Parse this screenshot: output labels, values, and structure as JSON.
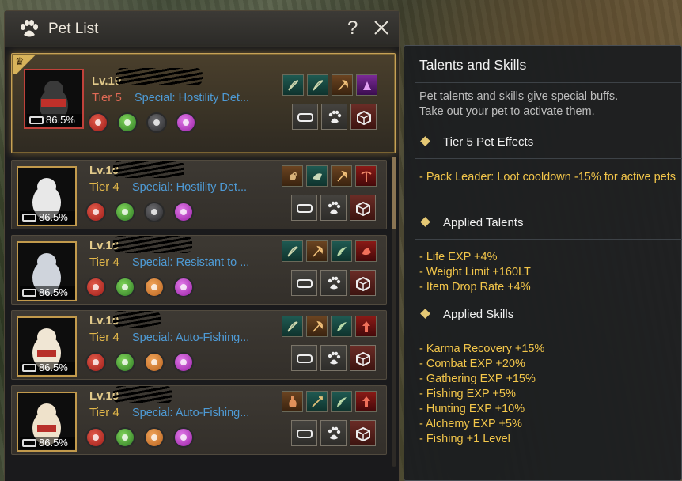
{
  "window": {
    "title": "Pet List",
    "help_label": "?"
  },
  "pets": [
    {
      "level": "Lv.10",
      "tier": "Tier 5",
      "tier_color": "#e06a55",
      "special": "Special: Hostility Det...",
      "hunger": "86.5%",
      "selected": true,
      "talents": [
        "bow-icon",
        "bow-icon",
        "axe-icon",
        "purple-tier-icon"
      ],
      "skills": [
        "red",
        "green",
        "gray",
        "purple"
      ]
    },
    {
      "level": "Lv.10",
      "tier": "Tier 4",
      "tier_color": "#e3b84a",
      "special": "Special: Hostility Det...",
      "hunger": "86.5%",
      "talents": [
        "scorpion-icon",
        "wolf-icon",
        "axe-icon",
        "pickaxe-icon"
      ],
      "skills": [
        "red",
        "green",
        "gray",
        "purple"
      ]
    },
    {
      "level": "Lv.10",
      "tier": "Tier 4",
      "tier_color": "#e3b84a",
      "special": "Special: Resistant to ...",
      "hunger": "86.5%",
      "talents": [
        "bow-icon",
        "axe-icon",
        "wing-icon",
        "hand-icon"
      ],
      "skills": [
        "red",
        "green",
        "orange",
        "purple"
      ]
    },
    {
      "level": "Lv.10",
      "tier": "Tier 4",
      "tier_color": "#e3b84a",
      "special": "Special: Auto-Fishing...",
      "hunger": "86.5%",
      "talents": [
        "bow-icon",
        "axe-icon",
        "wing-icon",
        "tier-up-icon"
      ],
      "skills": [
        "red",
        "green",
        "orange",
        "purple"
      ]
    },
    {
      "level": "Lv.10",
      "tier": "Tier 4",
      "tier_color": "#e3b84a",
      "special": "Special: Auto-Fishing...",
      "hunger": "86.5%",
      "talents": [
        "potion-icon",
        "spear-icon",
        "wing-icon",
        "tier-up-icon"
      ],
      "skills": [
        "red",
        "green",
        "orange",
        "purple"
      ]
    }
  ],
  "tooltip": {
    "title": "Talents and Skills",
    "description_1": "Pet talents and skills give special buffs.",
    "description_2": "Take out your pet to activate them.",
    "effects_header": "Tier 5 Pet Effects",
    "effect_line": "- Pack Leader: Loot cooldown -15% for active pets",
    "talents_header": "Applied Talents",
    "talents": [
      "- Life EXP +4%",
      "- Weight Limit +160LT",
      "- Item Drop Rate +4%"
    ],
    "skills_header": "Applied Skills",
    "skills": [
      "- Karma Recovery +15%",
      "- Combat EXP +20%",
      "- Gathering EXP +15%",
      "- Fishing EXP +5%",
      "- Hunting EXP +10%",
      "- Alchemy EXP +5%",
      "- Fishing +1 Level"
    ]
  }
}
